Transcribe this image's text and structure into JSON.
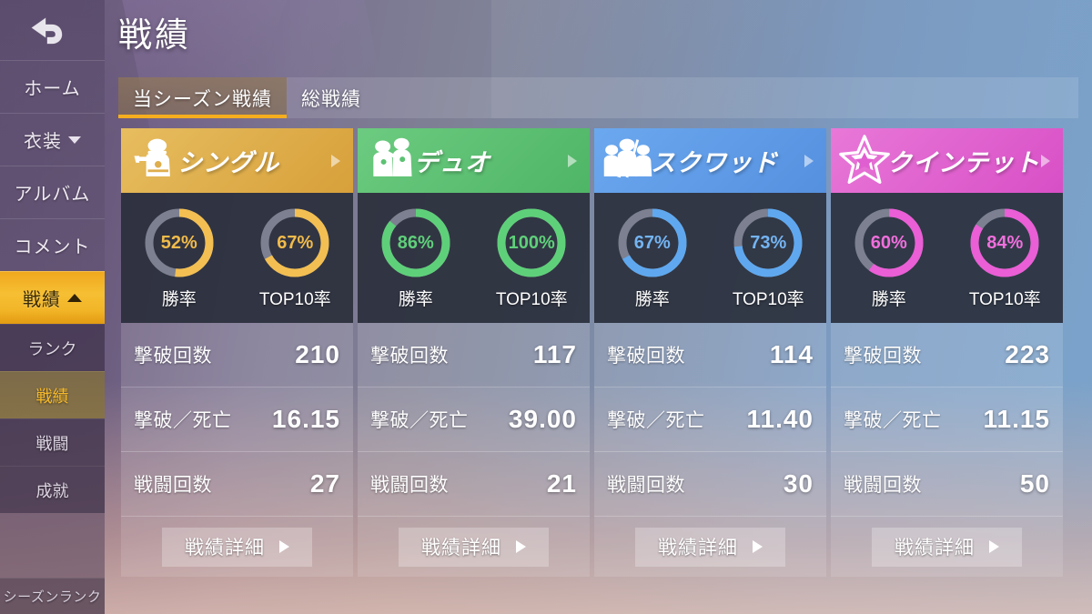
{
  "header": {
    "title": "戦績",
    "back_icon": "back-arrow-icon"
  },
  "sidebar": {
    "items": [
      {
        "label": "ホーム",
        "state": "normal",
        "icon": null
      },
      {
        "label": "衣装",
        "state": "normal",
        "icon": "chevron-down-icon"
      },
      {
        "label": "アルバム",
        "state": "normal",
        "icon": null
      },
      {
        "label": "コメント",
        "state": "normal",
        "icon": null
      },
      {
        "label": "戦績",
        "state": "active",
        "icon": "chevron-up-icon"
      }
    ],
    "subitems": [
      {
        "label": "ランク",
        "state": "normal"
      },
      {
        "label": "戦績",
        "state": "selected"
      },
      {
        "label": "戦闘",
        "state": "normal"
      },
      {
        "label": "成就",
        "state": "normal"
      }
    ],
    "footer": {
      "label": "シーズンランク"
    }
  },
  "tabs": [
    {
      "label": "当シーズン戦績",
      "active": true
    },
    {
      "label": "総戦績",
      "active": false
    }
  ],
  "colors": {
    "accent": "#f5ae1e",
    "single": "#e0ae45",
    "duo": "#55c070",
    "squad": "#5e9ce8",
    "quintet": "#e05fd0",
    "track": "#7c8090"
  },
  "cards": [
    {
      "mode": "シングル",
      "icon": "single-soldier-icon",
      "color": "#dfae4d",
      "head_gradient_from": "#e7bd5f",
      "head_gradient_to": "#d7a03a",
      "ring_color": "#f3bf52",
      "pct_text_color": "#f0bb4b",
      "donuts": [
        {
          "label": "勝率",
          "value": 52,
          "display": "52%"
        },
        {
          "label": "TOP10率",
          "value": 67,
          "display": "67%"
        }
      ],
      "stats": [
        {
          "label": "撃破回数",
          "value": "210"
        },
        {
          "label": "撃破／死亡",
          "value": "16.15"
        },
        {
          "label": "戦闘回数",
          "value": "27"
        }
      ],
      "button": "戦績詳細"
    },
    {
      "mode": "デュオ",
      "icon": "duo-soldiers-icon",
      "color": "#5cc273",
      "head_gradient_from": "#6ccb80",
      "head_gradient_to": "#4fb566",
      "ring_color": "#5fd07a",
      "pct_text_color": "#5fd07a",
      "donuts": [
        {
          "label": "勝率",
          "value": 86,
          "display": "86%"
        },
        {
          "label": "TOP10率",
          "value": 100,
          "display": "100%"
        }
      ],
      "stats": [
        {
          "label": "撃破回数",
          "value": "117"
        },
        {
          "label": "撃破／死亡",
          "value": "39.00"
        },
        {
          "label": "戦闘回数",
          "value": "21"
        }
      ],
      "button": "戦績詳細"
    },
    {
      "mode": "スクワッド",
      "icon": "squad-soldiers-icon",
      "color": "#5e9ce8",
      "head_gradient_from": "#6ba8ef",
      "head_gradient_to": "#5590df",
      "ring_color": "#5fa8ef",
      "pct_text_color": "#74b4f2",
      "donuts": [
        {
          "label": "勝率",
          "value": 67,
          "display": "67%"
        },
        {
          "label": "TOP10率",
          "value": 73,
          "display": "73%"
        }
      ],
      "stats": [
        {
          "label": "撃破回数",
          "value": "114"
        },
        {
          "label": "撃破／死亡",
          "value": "11.40"
        },
        {
          "label": "戦闘回数",
          "value": "30"
        }
      ],
      "button": "戦績詳細"
    },
    {
      "mode": "クインテット",
      "icon": "quintet-star-icon",
      "color": "#e05fd0",
      "head_gradient_from": "#e878d8",
      "head_gradient_to": "#d84fc6",
      "ring_color": "#ea5ed6",
      "pct_text_color": "#f06fdd",
      "donuts": [
        {
          "label": "勝率",
          "value": 60,
          "display": "60%"
        },
        {
          "label": "TOP10率",
          "value": 84,
          "display": "84%"
        }
      ],
      "stats": [
        {
          "label": "撃破回数",
          "value": "223"
        },
        {
          "label": "撃破／死亡",
          "value": "11.15"
        },
        {
          "label": "戦闘回数",
          "value": "50"
        }
      ],
      "button": "戦績詳細"
    }
  ]
}
